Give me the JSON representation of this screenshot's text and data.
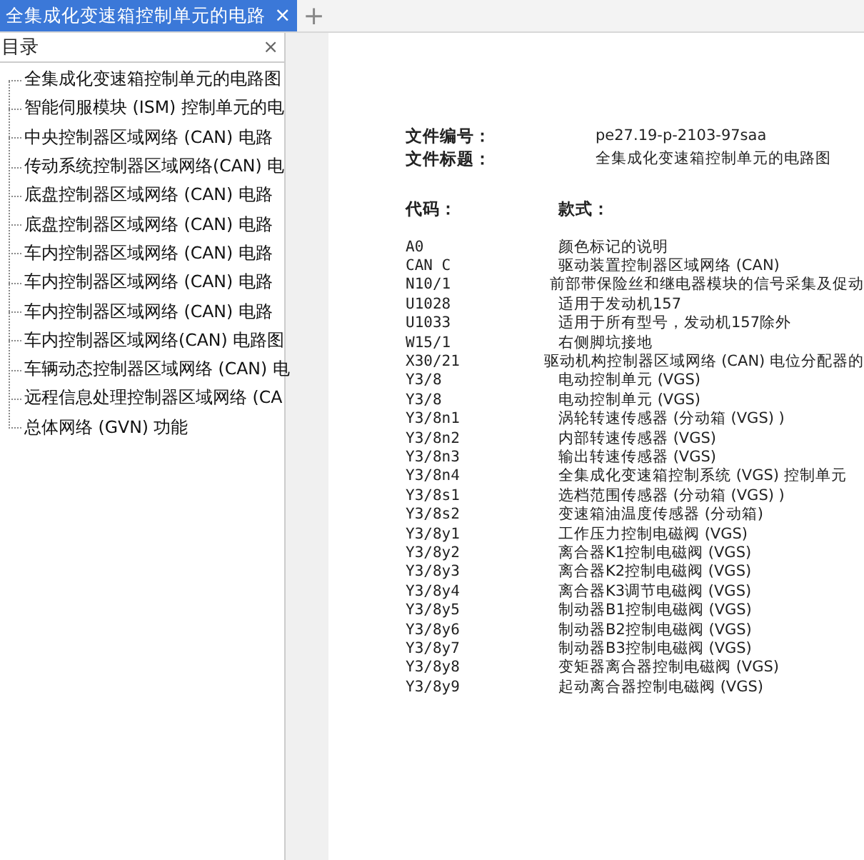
{
  "tab": {
    "title": "全集成化变速箱控制单元的电路",
    "close": "×",
    "new_tab": "+"
  },
  "sidebar": {
    "title": "目录",
    "close": "×",
    "items": [
      {
        "label": "全集成化变速箱控制单元的电路图"
      },
      {
        "label": "智能伺服模块 (ISM) 控制单元的电"
      },
      {
        "label": "中央控制器区域网络 (CAN) 电路"
      },
      {
        "label": "传动系统控制器区域网络(CAN) 电"
      },
      {
        "label": "底盘控制器区域网络 (CAN) 电路"
      },
      {
        "label": "底盘控制器区域网络 (CAN) 电路"
      },
      {
        "label": "车内控制器区域网络 (CAN) 电路"
      },
      {
        "label": "车内控制器区域网络 (CAN) 电路"
      },
      {
        "label": "车内控制器区域网络 (CAN) 电路"
      },
      {
        "label": "车内控制器区域网络(CAN) 电路图"
      },
      {
        "label": "车辆动态控制器区域网络 (CAN) 电"
      },
      {
        "label": "远程信息处理控制器区域网络 (CA"
      },
      {
        "label": "总体网络 (GVN) 功能"
      }
    ]
  },
  "document": {
    "fields": [
      {
        "label": "文件编号：",
        "value": "pe27.19-p-2103-97saa"
      },
      {
        "label": "文件标题：",
        "value": "全集成化变速箱控制单元的电路图"
      }
    ],
    "columns": [
      "代码：",
      "款式："
    ],
    "rows": [
      {
        "code": "A0",
        "description": "颜色标记的说明"
      },
      {
        "code": "CAN C",
        "description": "驱动装置控制器区域网络 (CAN)"
      },
      {
        "code": "N10/1",
        "description": "前部带保险丝和继电器模块的信号采集及促动"
      },
      {
        "code": "U1028",
        "description": "适用于发动机157"
      },
      {
        "code": "U1033",
        "description": "适用于所有型号，发动机157除外"
      },
      {
        "code": "W15/1",
        "description": "右侧脚坑接地"
      },
      {
        "code": "X30/21",
        "description": "驱动机构控制器区域网络 (CAN) 电位分配器的"
      },
      {
        "code": "Y3/8",
        "description": "电动控制单元 (VGS)"
      },
      {
        "code": "Y3/8",
        "description": "电动控制单元 (VGS)"
      },
      {
        "code": "Y3/8n1",
        "description": "涡轮转速传感器 (分动箱 (VGS) )"
      },
      {
        "code": "Y3/8n2",
        "description": "内部转速传感器 (VGS)"
      },
      {
        "code": "Y3/8n3",
        "description": "输出转速传感器 (VGS)"
      },
      {
        "code": "Y3/8n4",
        "description": "全集成化变速箱控制系统 (VGS) 控制单元"
      },
      {
        "code": "Y3/8s1",
        "description": "选档范围传感器 (分动箱 (VGS) )"
      },
      {
        "code": "Y3/8s2",
        "description": "变速箱油温度传感器 (分动箱)"
      },
      {
        "code": "Y3/8y1",
        "description": "工作压力控制电磁阀 (VGS)"
      },
      {
        "code": "Y3/8y2",
        "description": "离合器K1控制电磁阀 (VGS)"
      },
      {
        "code": "Y3/8y3",
        "description": "离合器K2控制电磁阀 (VGS)"
      },
      {
        "code": "Y3/8y4",
        "description": "离合器K3调节电磁阀 (VGS)"
      },
      {
        "code": "Y3/8y5",
        "description": "制动器B1控制电磁阀 (VGS)"
      },
      {
        "code": "Y3/8y6",
        "description": "制动器B2控制电磁阀 (VGS)"
      },
      {
        "code": "Y3/8y7",
        "description": "制动器B3控制电磁阀 (VGS)"
      },
      {
        "code": "Y3/8y8",
        "description": "变矩器离合器控制电磁阀 (VGS)"
      },
      {
        "code": "Y3/8y9",
        "description": "起动离合器控制电磁阀 (VGS)"
      }
    ]
  }
}
